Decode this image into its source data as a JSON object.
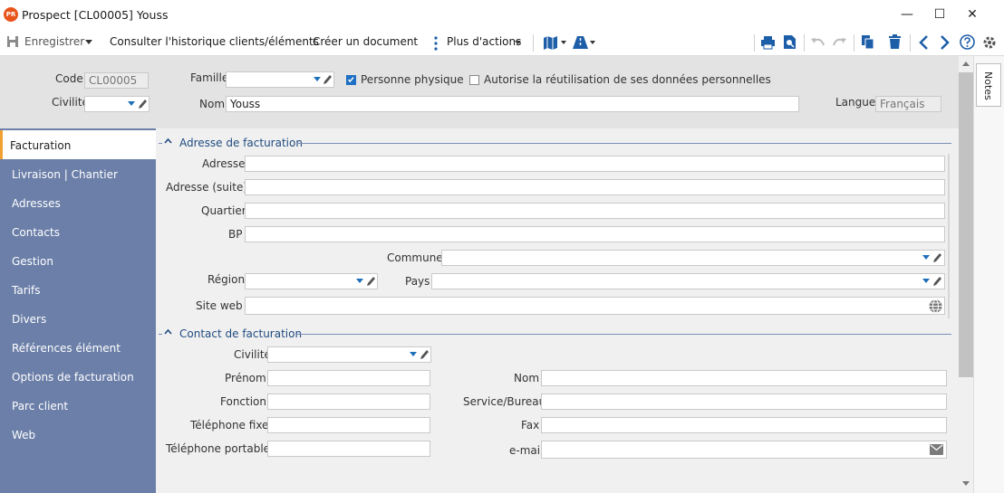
{
  "window": {
    "logo": "PR",
    "title": "Prospect [CL00005] Youss",
    "minimize": "—",
    "maximize": "☐",
    "close": "✕"
  },
  "toolbar": {
    "save_label": "Enregistrer",
    "history_label": "Consulter l'historique clients/éléments",
    "create_doc_label": "Créer un document",
    "more_actions_label": "Plus d'actions"
  },
  "header": {
    "code_label": "Code",
    "code_value": "CL00005",
    "famille_label": "Famille",
    "famille_value": "",
    "personne_label": "Personne physique",
    "personne_checked": true,
    "autorise_label": "Autorise la réutilisation de ses données personnelles",
    "autorise_checked": false,
    "civilite_label": "Civilité",
    "civilite_value": "",
    "nom_label": "Nom",
    "nom_value": "Youss",
    "langue_label": "Langue",
    "langue_value": "Français"
  },
  "sidebar": {
    "items": [
      {
        "label": "Facturation",
        "active": true
      },
      {
        "label": "Livraison | Chantier"
      },
      {
        "label": "Adresses"
      },
      {
        "label": "Contacts"
      },
      {
        "label": "Gestion"
      },
      {
        "label": "Tarifs"
      },
      {
        "label": "Divers"
      },
      {
        "label": "Références élément"
      },
      {
        "label": "Options de facturation"
      },
      {
        "label": "Parc client"
      },
      {
        "label": "Web"
      }
    ]
  },
  "billing_address": {
    "title": "Adresse de facturation",
    "adresse_label": "Adresse",
    "adresse_value": "",
    "adresse_suite_label": "Adresse (suite)",
    "adresse_suite_value": "",
    "quartier_label": "Quartier",
    "quartier_value": "",
    "bp_label": "BP",
    "bp_value": "",
    "commune_label": "Commune",
    "commune_value": "",
    "region_label": "Région",
    "region_value": "",
    "pays_label": "Pays",
    "pays_value": "",
    "site_label": "Site web",
    "site_value": ""
  },
  "billing_contact": {
    "title": "Contact de facturation",
    "civilite_label": "Civilité",
    "civilite_value": "",
    "prenom_label": "Prénom",
    "prenom_value": "",
    "nom_label": "Nom",
    "nom_value": "",
    "fonction_label": "Fonction",
    "fonction_value": "",
    "service_label": "Service/Bureau",
    "service_value": "",
    "tel_fixe_label": "Téléphone fixe",
    "tel_fixe_value": "",
    "fax_label": "Fax",
    "fax_value": "",
    "tel_portable_label": "Téléphone portable",
    "tel_portable_value": "",
    "email_label": "e-mail",
    "email_value": ""
  },
  "notes": {
    "label": "Notes"
  },
  "colors": {
    "sidebar": "#6b7fa8",
    "accent": "#1f6fc4",
    "active_marker": "#f0a030",
    "section": "#1f4b80"
  }
}
